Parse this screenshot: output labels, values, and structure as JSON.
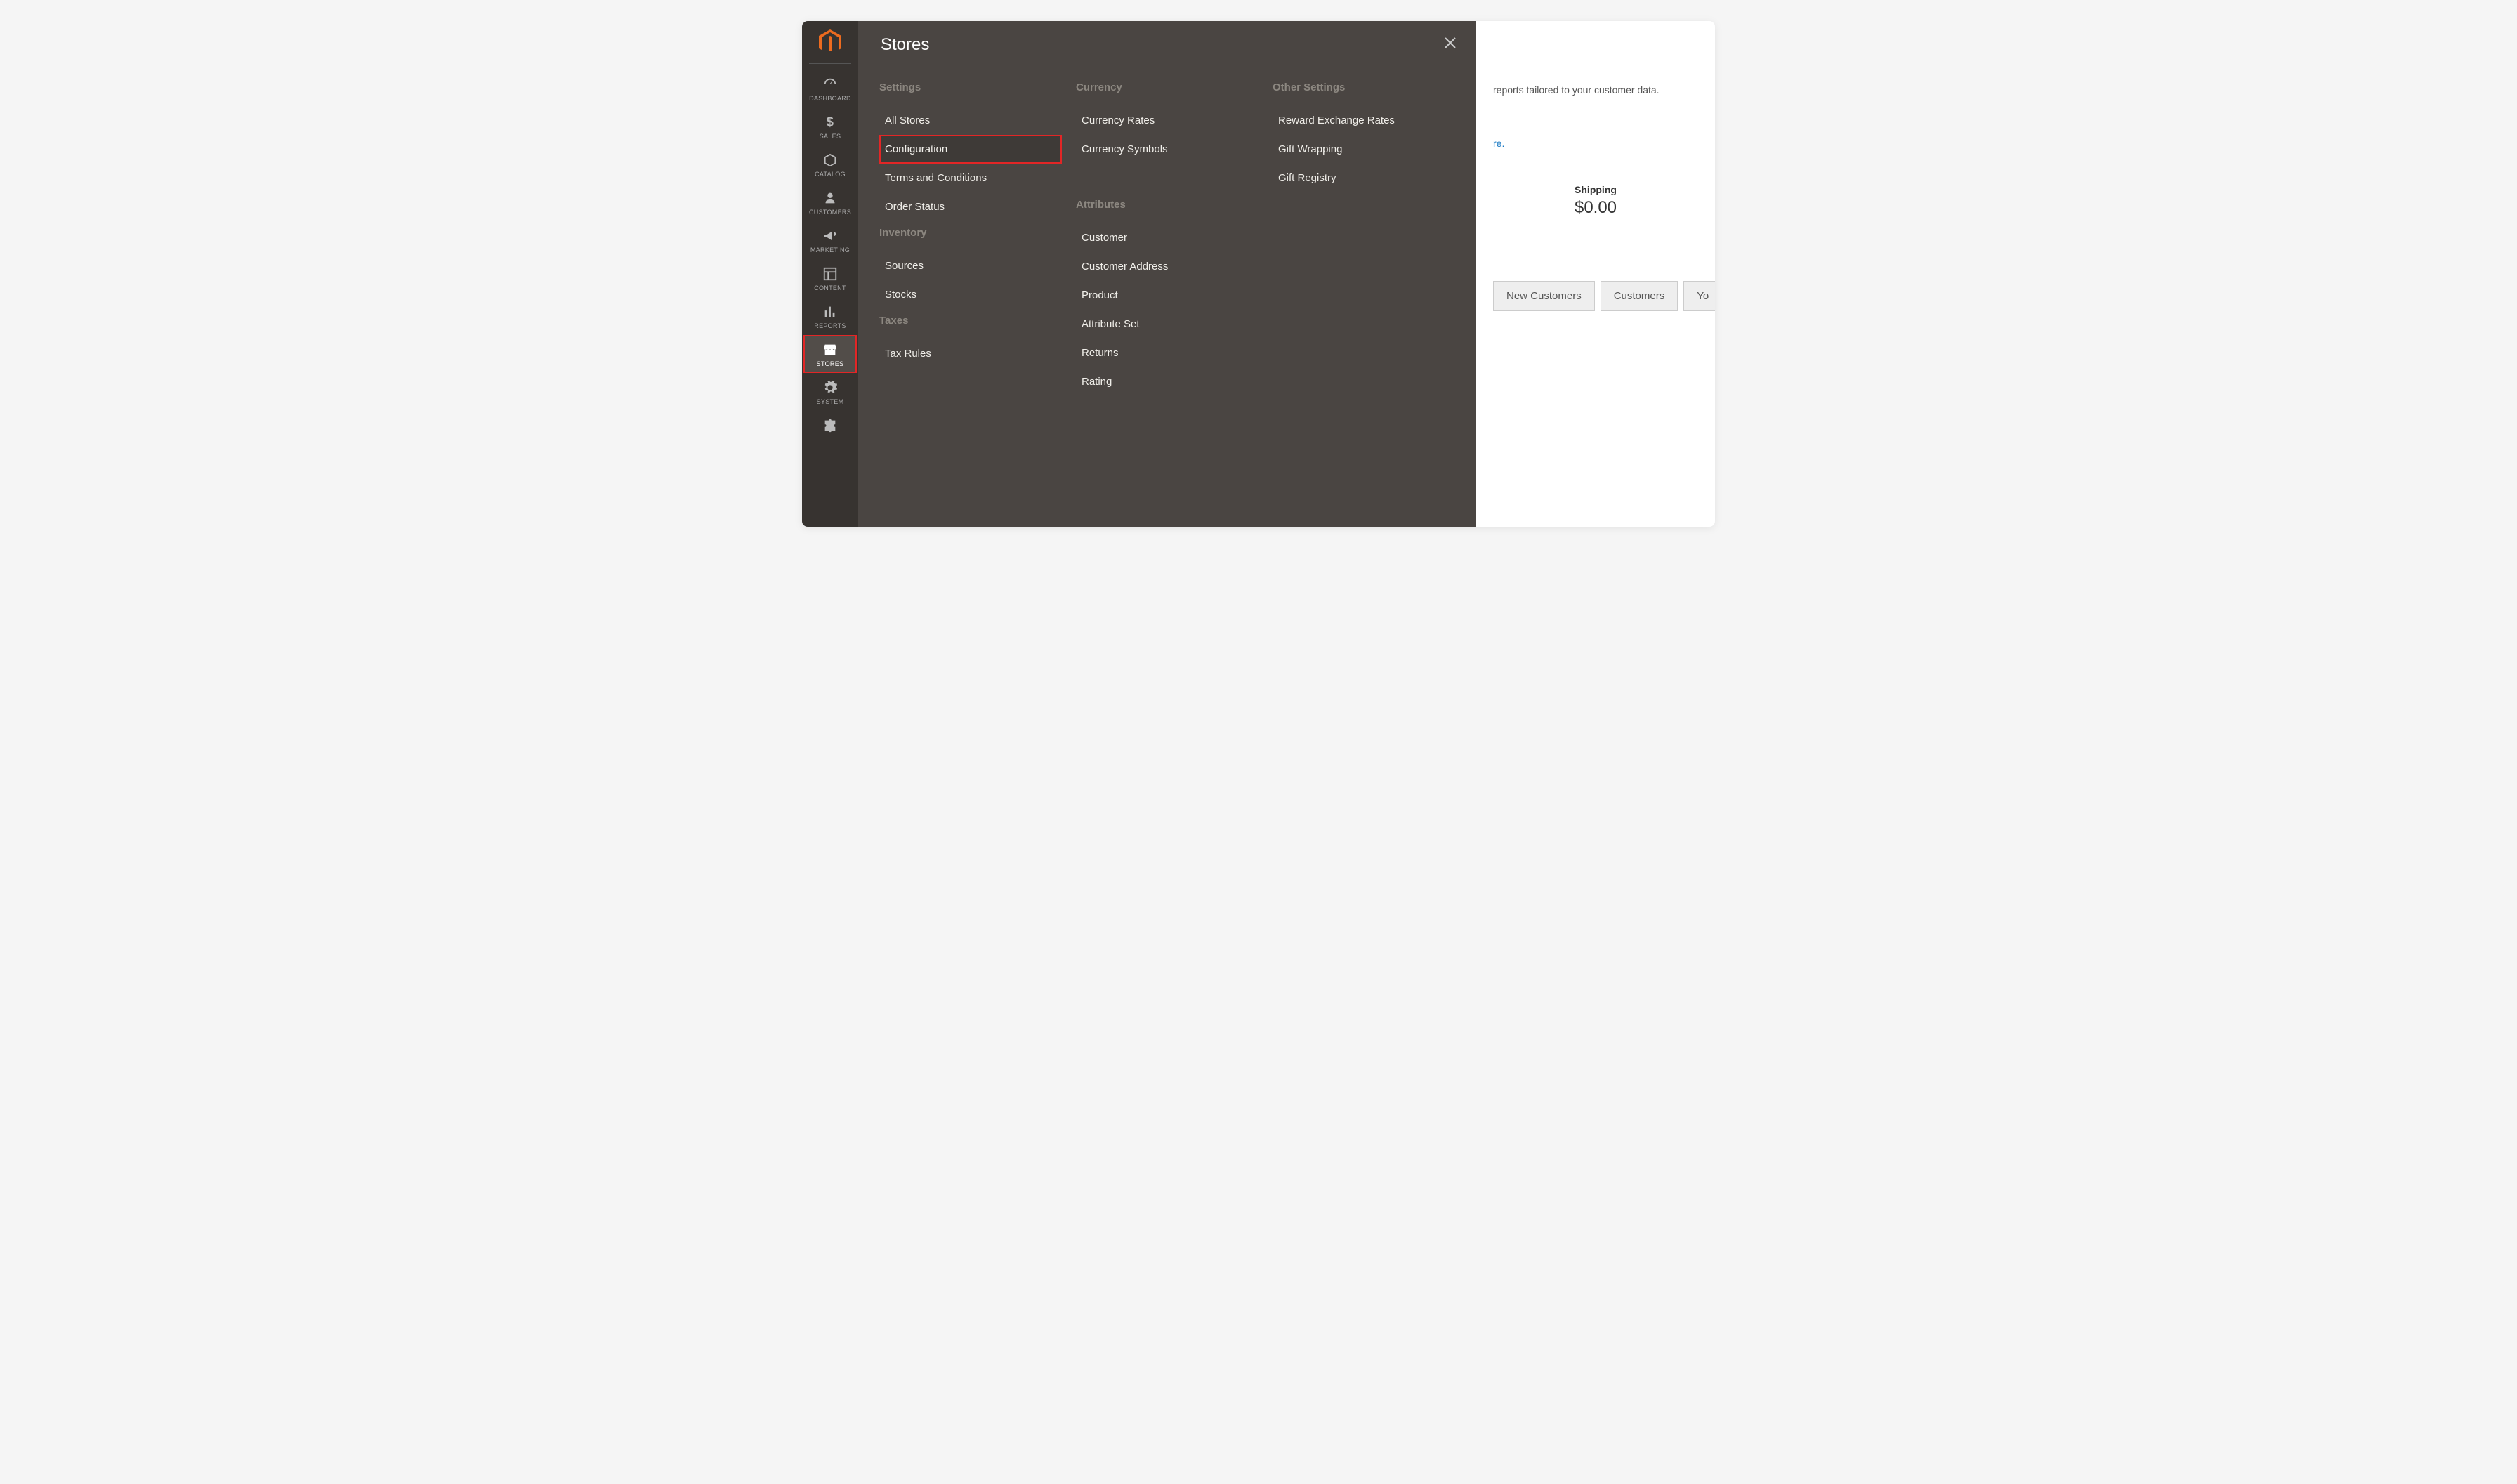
{
  "flyout": {
    "title": "Stores",
    "columns": [
      {
        "groups": [
          {
            "head": "Settings",
            "items": [
              "All Stores",
              "Configuration",
              "Terms and Conditions",
              "Order Status"
            ],
            "activeIndex": 1,
            "highlightedIndex": 1
          },
          {
            "head": "Inventory",
            "items": [
              "Sources",
              "Stocks"
            ]
          },
          {
            "head": "Taxes",
            "items": [
              "Tax Rules"
            ]
          }
        ]
      },
      {
        "groups": [
          {
            "head": "Currency",
            "items": [
              "Currency Rates",
              "Currency Symbols"
            ]
          },
          {
            "head": "Attributes",
            "items": [
              "Customer",
              "Customer Address",
              "Product",
              "Attribute Set",
              "Returns",
              "Rating"
            ],
            "spaced": true
          }
        ]
      },
      {
        "groups": [
          {
            "head": "Other Settings",
            "items": [
              "Reward Exchange Rates",
              "Gift Wrapping",
              "Gift Registry"
            ]
          }
        ]
      }
    ]
  },
  "sidebar": {
    "items": [
      {
        "label": "DASHBOARD",
        "icon": "dashboard"
      },
      {
        "label": "SALES",
        "icon": "dollar"
      },
      {
        "label": "CATALOG",
        "icon": "box"
      },
      {
        "label": "CUSTOMERS",
        "icon": "person"
      },
      {
        "label": "MARKETING",
        "icon": "megaphone"
      },
      {
        "label": "CONTENT",
        "icon": "layout"
      },
      {
        "label": "REPORTS",
        "icon": "bars"
      },
      {
        "label": "STORES",
        "icon": "store",
        "active": true,
        "highlighted": true
      },
      {
        "label": "SYSTEM",
        "icon": "gear"
      },
      {
        "label": "",
        "icon": "puzzle"
      }
    ]
  },
  "content": {
    "text_fragment": "reports tailored to your customer data.",
    "link_fragment": "re.",
    "shipping_label": "Shipping",
    "shipping_value": "$0.00",
    "tabs": [
      "New Customers",
      "Customers",
      "Yo"
    ]
  }
}
